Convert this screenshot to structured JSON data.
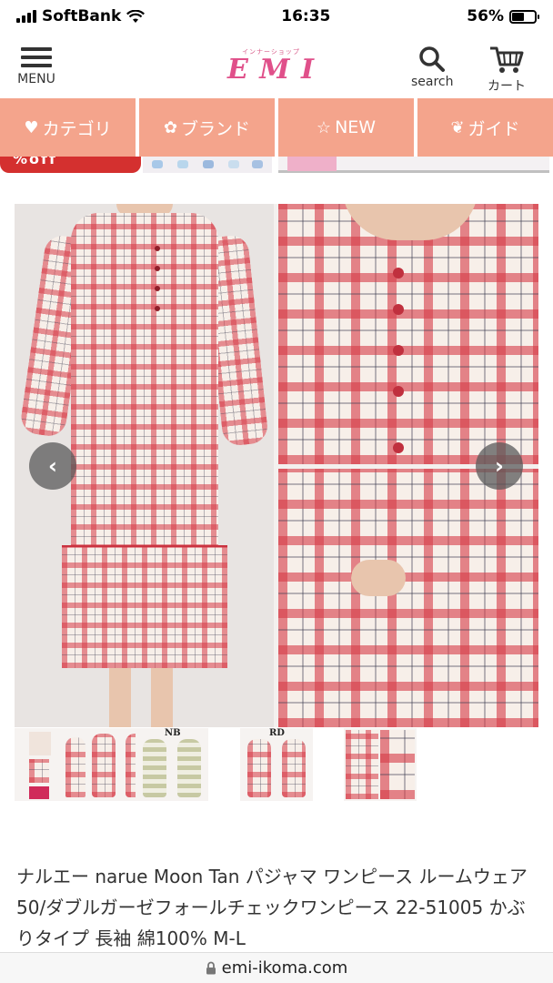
{
  "status": {
    "carrier": "SoftBank",
    "time": "16:35",
    "battery": "56%",
    "battery_level": 0.56,
    "signal_bars": 4
  },
  "header": {
    "menu_label": "MENU",
    "logo_text": "E M I",
    "logo_sub": "インナーショップ",
    "search_label": "search",
    "cart_label": "カート"
  },
  "nav": {
    "items": [
      {
        "icon": "heart-icon",
        "label": "カテゴリ"
      },
      {
        "icon": "flower-icon",
        "label": "ブランド"
      },
      {
        "icon": "star-icon",
        "label": "NEW"
      },
      {
        "icon": "leaf-icon",
        "label": "ガイド"
      }
    ]
  },
  "banner": {
    "partial_text": "%off"
  },
  "gallery": {
    "prev_icon": "chevron-left-icon",
    "next_icon": "chevron-right-icon"
  },
  "thumbnails": [
    {
      "label": "",
      "kind": "package"
    },
    {
      "label": "",
      "kind": "model"
    },
    {
      "label": "NB",
      "kind": "navy-pair"
    },
    {
      "label": "RD",
      "kind": "red-pair"
    },
    {
      "label": "",
      "kind": "detail"
    }
  ],
  "product": {
    "title": "ナルエー narue Moon Tan パジャマ ワンピース ルームウェア 50/ダブルガーゼフォールチェックワンピース 22-51005 かぶりタイプ 長袖 綿100% M-L"
  },
  "urlbar": {
    "url": "emi-ikoma.com"
  },
  "colors": {
    "nav_bg": "#f4a48c",
    "logo_pink": "#e0508a",
    "check_red": "#d63a46"
  }
}
